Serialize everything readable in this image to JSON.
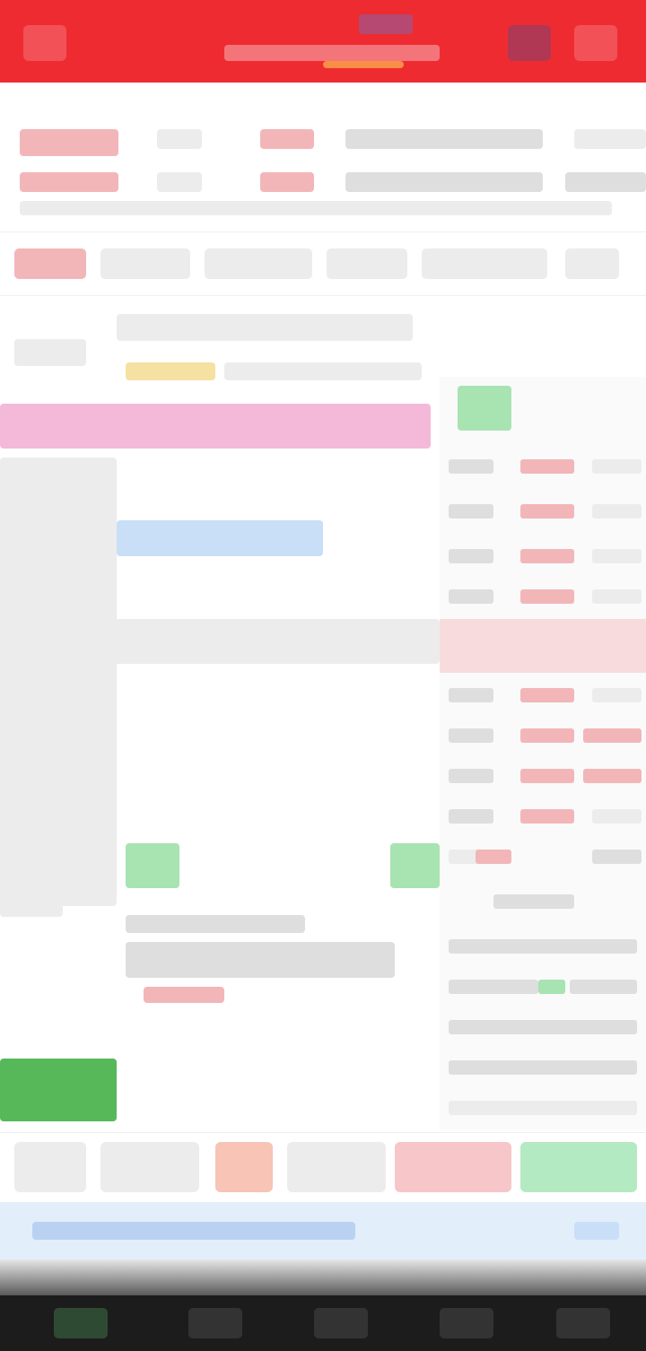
{
  "colors": {
    "header": "#ef2b32",
    "up": "#e95a60",
    "down": "#57b85a",
    "notice": "#e3eefb",
    "tab_bar": "#1c1c1c"
  },
  "icons": {
    "back": "chevron-left-icon",
    "tools": "tools-icon",
    "menu": "menu-icon"
  },
  "header": {
    "title": "",
    "subtitle": ""
  },
  "info": {
    "price": "",
    "change": "",
    "change_pct": ""
  },
  "period_tabs": [
    "",
    "",
    "",
    "",
    "",
    "",
    ""
  ],
  "actions": [
    "",
    "",
    "",
    "",
    "",
    ""
  ],
  "notice": {
    "text": ""
  },
  "bottom_tabs": [
    "",
    "",
    "",
    "",
    ""
  ]
}
